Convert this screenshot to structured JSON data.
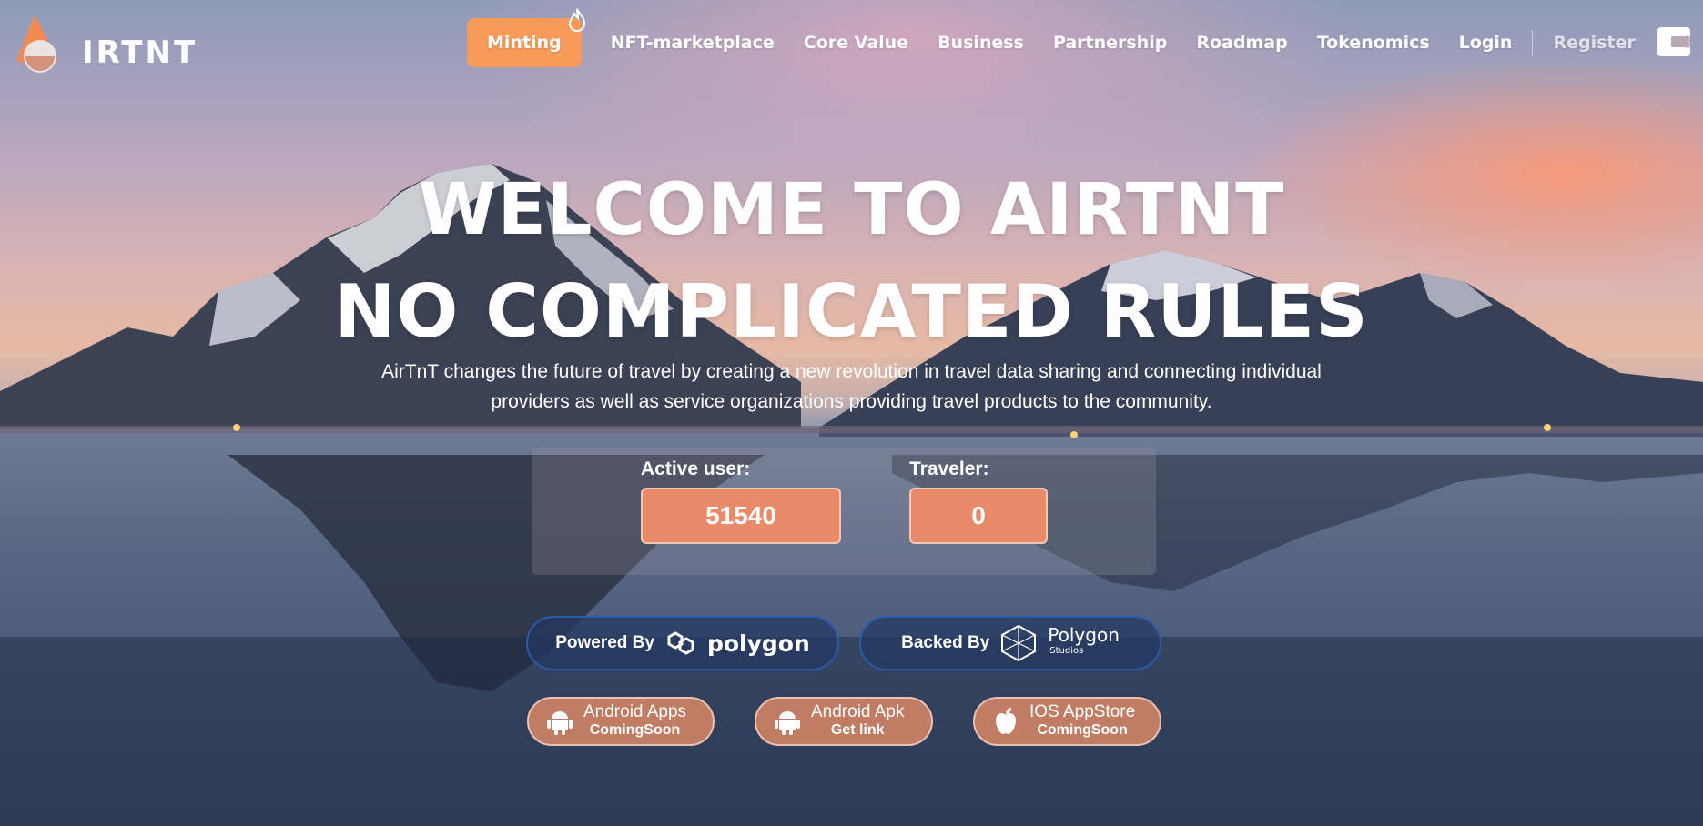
{
  "brand": {
    "logo_text": "IRTNT"
  },
  "nav": {
    "minting": "Minting",
    "items": [
      "NFT-marketplace",
      "Core Value",
      "Business",
      "Partnership",
      "Roadmap",
      "Tokenomics",
      "Login"
    ],
    "register": "Register"
  },
  "hero": {
    "title_line1": "WELCOME TO AIRTNT",
    "title_line2": "NO COMPLICATED RULES",
    "description_line1": "AirTnT changes the future of travel by creating a new revolution in travel data sharing and connecting individual",
    "description_line2": "providers as well as service organizations providing travel products to the community."
  },
  "stats": {
    "active_user_label": "Active user:",
    "active_user_value": "51540",
    "traveler_label": "Traveler:",
    "traveler_value": "0"
  },
  "partners": {
    "powered_label": "Powered By",
    "powered_name": "polygon",
    "backed_label": "Backed By",
    "backed_name": "Polygon",
    "backed_sub": "Studios"
  },
  "apps": [
    {
      "title": "Android Apps",
      "subtitle": "ComingSoon",
      "icon": "android-icon"
    },
    {
      "title": "Android Apk",
      "subtitle": "Get link",
      "icon": "android-icon"
    },
    {
      "title": "IOS AppStore",
      "subtitle": "ComingSoon",
      "icon": "apple-icon"
    }
  ],
  "colors": {
    "accent_orange": "#f79a5a",
    "stat_box": "#e98b68",
    "polygon_border": "#2a5aa8",
    "app_button": "#c17c64"
  }
}
